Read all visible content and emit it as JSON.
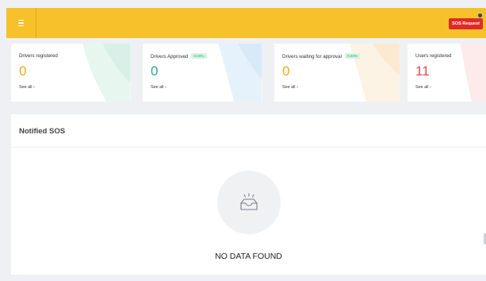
{
  "topbar": {
    "menu_icon": "hamburger-menu-icon",
    "sos_label": "SOS Request",
    "brand_color": "#f6c12a",
    "sos_color": "#e02a2a"
  },
  "cards": [
    {
      "title": "Drivers registered",
      "badge": "",
      "value": "0",
      "value_color": "#f0a81a",
      "link": "See all ›"
    },
    {
      "title": "Drivers Approved",
      "badge": "0.00%",
      "value": "0",
      "value_color": "#2aa89a",
      "link": "See all ›"
    },
    {
      "title": "Drivers waiting for approval",
      "badge": "0.00%",
      "value": "0",
      "value_color": "#f0a81a",
      "link": "See all ›"
    },
    {
      "title": "Users registered",
      "badge": "",
      "value": "11",
      "value_color": "#e04a4a",
      "link": "See all ›"
    }
  ],
  "panel": {
    "title": "Notified SOS",
    "empty_text": "NO DATA FOUND",
    "empty_icon": "empty-inbox-icon"
  }
}
